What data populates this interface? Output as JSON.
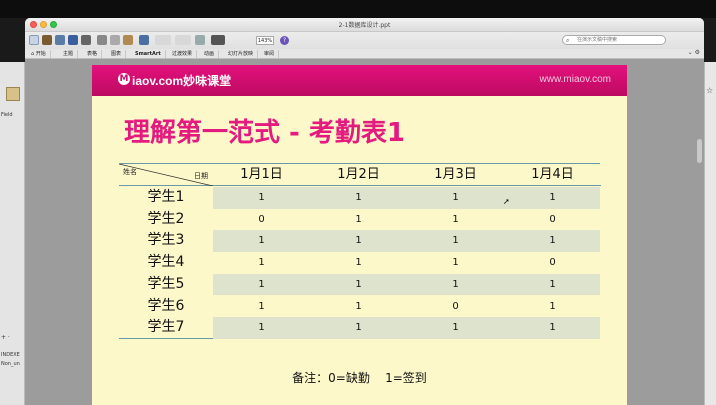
{
  "window": {
    "title": "2-1数据库设计.ppt"
  },
  "toolbar": {
    "zoom": "143%",
    "help": "?",
    "search_placeholder": "在演示文稿中搜索"
  },
  "ribbon": {
    "tabs": [
      "开始",
      "主题",
      "表格",
      "图表",
      "SmartArt",
      "过渡效果",
      "动画",
      "幻灯片放映",
      "审阅"
    ]
  },
  "left_panel": {
    "field_label": "Field",
    "bottom1": "INDEXE",
    "bottom2": "Non_un"
  },
  "slide": {
    "logo_text": "iaov.com妙味课堂",
    "logo_letter": "M",
    "site": "www.miaov.com",
    "title": "理解第一范式 - 考勤表1",
    "table": {
      "corner_name": "姓名",
      "corner_date": "日期",
      "columns": [
        "1月1日",
        "1月2日",
        "1月3日",
        "1月4日"
      ],
      "rows": [
        {
          "name": "学生1",
          "values": [
            "1",
            "1",
            "1",
            "1"
          ]
        },
        {
          "name": "学生2",
          "values": [
            "0",
            "1",
            "1",
            "0"
          ]
        },
        {
          "name": "学生3",
          "values": [
            "1",
            "1",
            "1",
            "1"
          ]
        },
        {
          "name": "学生4",
          "values": [
            "1",
            "1",
            "1",
            "0"
          ]
        },
        {
          "name": "学生5",
          "values": [
            "1",
            "1",
            "1",
            "1"
          ]
        },
        {
          "name": "学生6",
          "values": [
            "1",
            "1",
            "0",
            "1"
          ]
        },
        {
          "name": "学生7",
          "values": [
            "1",
            "1",
            "1",
            "1"
          ]
        }
      ]
    },
    "note": "备注：0=缺勤    1=签到"
  },
  "colors": {
    "accent": "#e41a7f",
    "header": "#c80c6a",
    "slide_bg": "#fdf8c9",
    "band": "#dde3cd"
  }
}
